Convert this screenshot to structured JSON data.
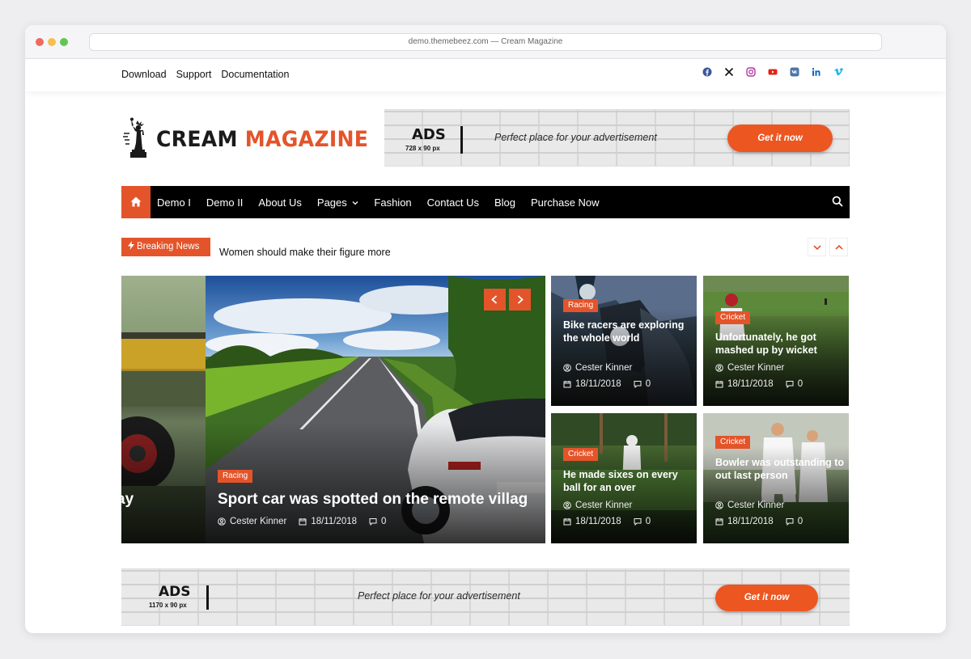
{
  "browser": {
    "url_text": "demo.themebeez.com — Cream Magazine"
  },
  "topbar": {
    "links": [
      "Download",
      "Support",
      "Documentation"
    ],
    "social_icons": [
      "facebook-icon",
      "x-icon",
      "instagram-icon",
      "youtube-icon",
      "vk-icon",
      "linkedin-icon",
      "vimeo-icon"
    ]
  },
  "logo": {
    "word1": "CREAM",
    "word2": "MAGAZINE"
  },
  "header_ad": {
    "label": "ADS",
    "size": "728 x 90 px",
    "text": "Perfect place for your advertisement",
    "button": "Get it now"
  },
  "nav": {
    "items": [
      "Demo I",
      "Demo II",
      "About Us",
      "Pages",
      "Fashion",
      "Contact Us",
      "Blog",
      "Purchase Now"
    ]
  },
  "breaking": {
    "label": "Breaking News",
    "headline": "Women should make their figure more"
  },
  "slider": {
    "prev_title_tail": "ay",
    "main": {
      "category": "Racing",
      "title": "Sport car was spotted on the remote villag",
      "author": "Cester Kinner",
      "date": "18/11/2018",
      "comments": "0"
    }
  },
  "cards": [
    {
      "category": "Racing",
      "title": "Bike racers are exploring the whole world",
      "author": "Cester Kinner",
      "date": "18/11/2018",
      "comments": "0"
    },
    {
      "category": "Cricket",
      "title": "Unfortunately, he got mashed up by wicket",
      "author": "Cester Kinner",
      "date": "18/11/2018",
      "comments": "0"
    },
    {
      "category": "Cricket",
      "title": "He made sixes on every ball for an over",
      "author": "Cester Kinner",
      "date": "18/11/2018",
      "comments": "0"
    },
    {
      "category": "Cricket",
      "title": "Bowler was outstanding to out last person",
      "author": "Cester Kinner",
      "date": "18/11/2018",
      "comments": "0"
    }
  ],
  "footer_ad": {
    "label": "ADS",
    "size": "1170 x 90 px",
    "text": "Perfect place for your advertisement",
    "button": "Get it now"
  },
  "colors": {
    "accent": "#e4542a",
    "nav_bg": "#000000",
    "ad_button": "#ec5621"
  }
}
